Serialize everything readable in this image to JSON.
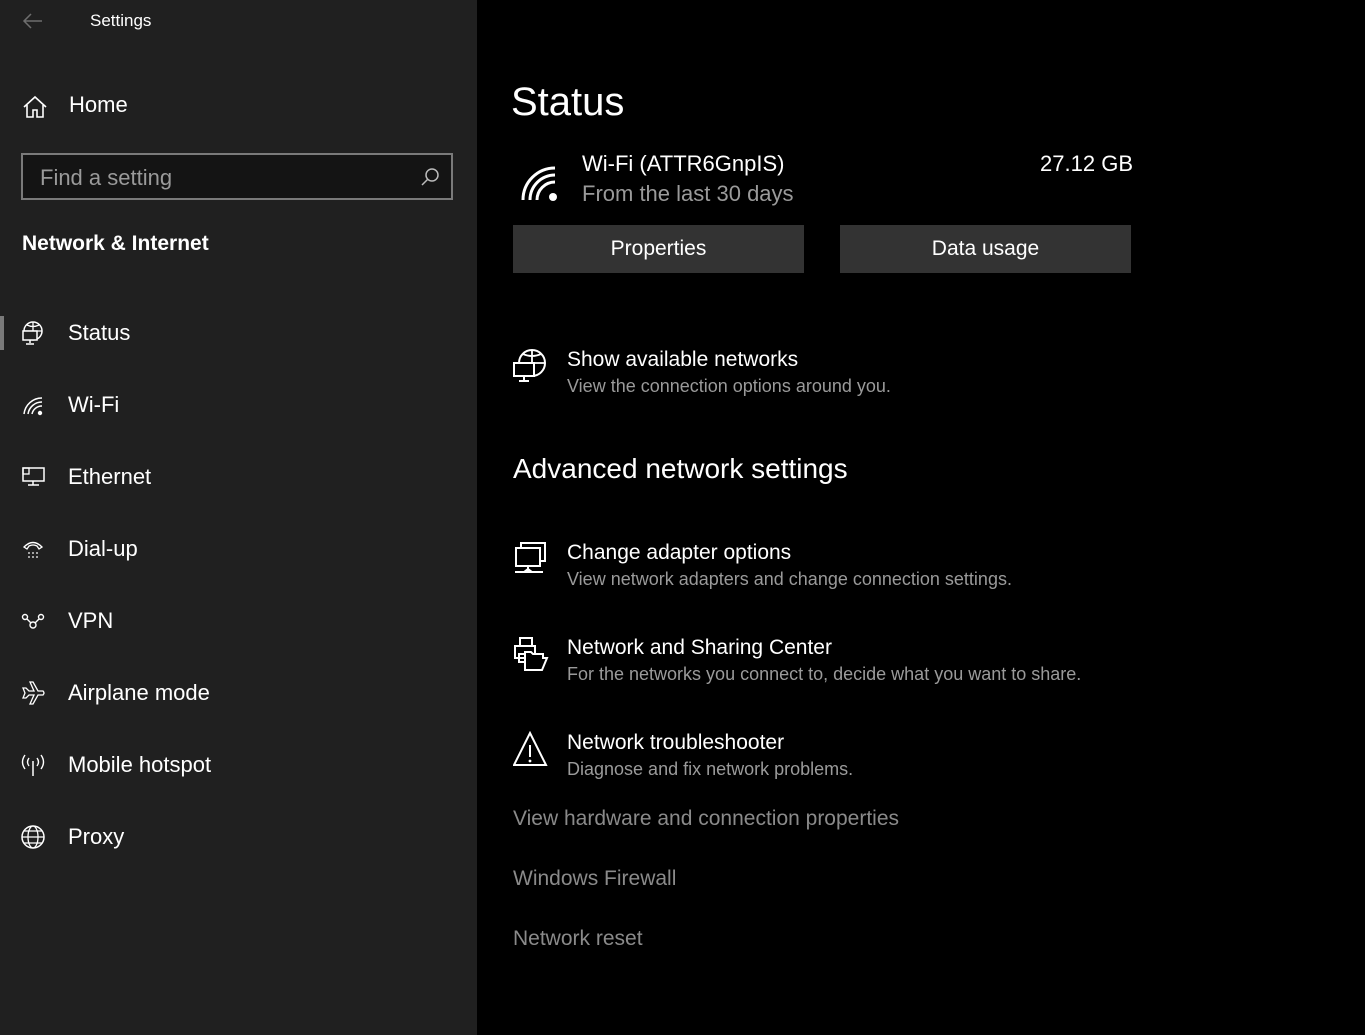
{
  "window": {
    "title": "Settings"
  },
  "sidebar": {
    "home_label": "Home",
    "search": {
      "placeholder": "Find a setting",
      "value": ""
    },
    "section_title": "Network & Internet",
    "items": [
      {
        "label": "Status",
        "icon": "globe-monitor-icon",
        "selected": true
      },
      {
        "label": "Wi-Fi",
        "icon": "wifi-icon",
        "selected": false
      },
      {
        "label": "Ethernet",
        "icon": "ethernet-icon",
        "selected": false
      },
      {
        "label": "Dial-up",
        "icon": "dialup-phone-icon",
        "selected": false
      },
      {
        "label": "VPN",
        "icon": "vpn-icon",
        "selected": false
      },
      {
        "label": "Airplane mode",
        "icon": "airplane-icon",
        "selected": false
      },
      {
        "label": "Mobile hotspot",
        "icon": "hotspot-antenna-icon",
        "selected": false
      },
      {
        "label": "Proxy",
        "icon": "globe-icon",
        "selected": false
      }
    ]
  },
  "main": {
    "page_title": "Status",
    "connection": {
      "name": "Wi-Fi (ATTR6GnpIS)",
      "subtitle": "From the last 30 days",
      "usage": "27.12 GB"
    },
    "buttons": {
      "properties": "Properties",
      "data_usage": "Data usage"
    },
    "show_networks": {
      "title": "Show available networks",
      "description": "View the connection options around you."
    },
    "advanced_heading": "Advanced network settings",
    "advanced_items": [
      {
        "title": "Change adapter options",
        "description": "View network adapters and change connection settings.",
        "icon": "adapter-monitors-icon"
      },
      {
        "title": "Network and Sharing Center",
        "description": "For the networks you connect to, decide what you want to share.",
        "icon": "printer-folder-icon"
      },
      {
        "title": "Network troubleshooter",
        "description": "Diagnose and fix network problems.",
        "icon": "warning-triangle-icon"
      }
    ],
    "links": [
      "View hardware and connection properties",
      "Windows Firewall",
      "Network reset"
    ]
  },
  "colors": {
    "sidebar_bg": "#202020",
    "main_bg": "#000000",
    "button_bg": "#333333",
    "secondary_text": "#9a9a9a",
    "link_text": "#8a8a8a",
    "selection_indicator": "#7a7a7a"
  }
}
